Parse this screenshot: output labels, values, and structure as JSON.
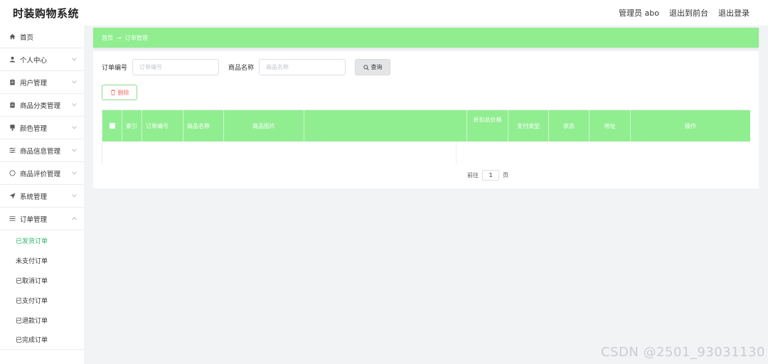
{
  "header": {
    "app_title": "时装购物系统",
    "admin": "管理员 abo",
    "to_front": "退出到前台",
    "logout": "退出登录"
  },
  "sidebar": {
    "items": [
      {
        "label": "首页",
        "icon": "home-icon"
      },
      {
        "label": "个人中心",
        "icon": "user-icon"
      },
      {
        "label": "用户管理",
        "icon": "clipboard-icon"
      },
      {
        "label": "商品分类管理",
        "icon": "clipboard-icon"
      },
      {
        "label": "颜色管理",
        "icon": "brush-icon"
      },
      {
        "label": "商品信息管理",
        "icon": "sliders-icon"
      },
      {
        "label": "商品评价管理",
        "icon": "circle-icon"
      },
      {
        "label": "系统管理",
        "icon": "send-icon"
      },
      {
        "label": "订单管理",
        "icon": "list-icon"
      }
    ],
    "sub_items": [
      "已发货订单",
      "未支付订单",
      "已取消订单",
      "已支付订单",
      "已退款订单",
      "已完成订单"
    ],
    "active_sub": 0
  },
  "breadcrumb": {
    "home": "首页",
    "current": "订单管理"
  },
  "filters": {
    "order_no_label": "订单编号",
    "order_no_placeholder": "订单编号",
    "product_name_label": "商品名称",
    "product_name_placeholder": "商品名称",
    "search_label": "查询"
  },
  "actions": {
    "delete_label": "删除"
  },
  "table": {
    "columns": [
      "索引",
      "订单编号",
      "商品名称",
      "商品图片",
      "",
      "折扣总价格",
      "支付类型",
      "状态",
      "地址",
      "操作"
    ]
  },
  "pagination": {
    "goto_label": "前往",
    "page_value": "1",
    "page_unit": "页"
  },
  "watermark": "CSDN @2501_93031130",
  "colors": {
    "accent_green": "#90ee90",
    "active_text": "#2db86c",
    "danger": "#f56c6c"
  }
}
